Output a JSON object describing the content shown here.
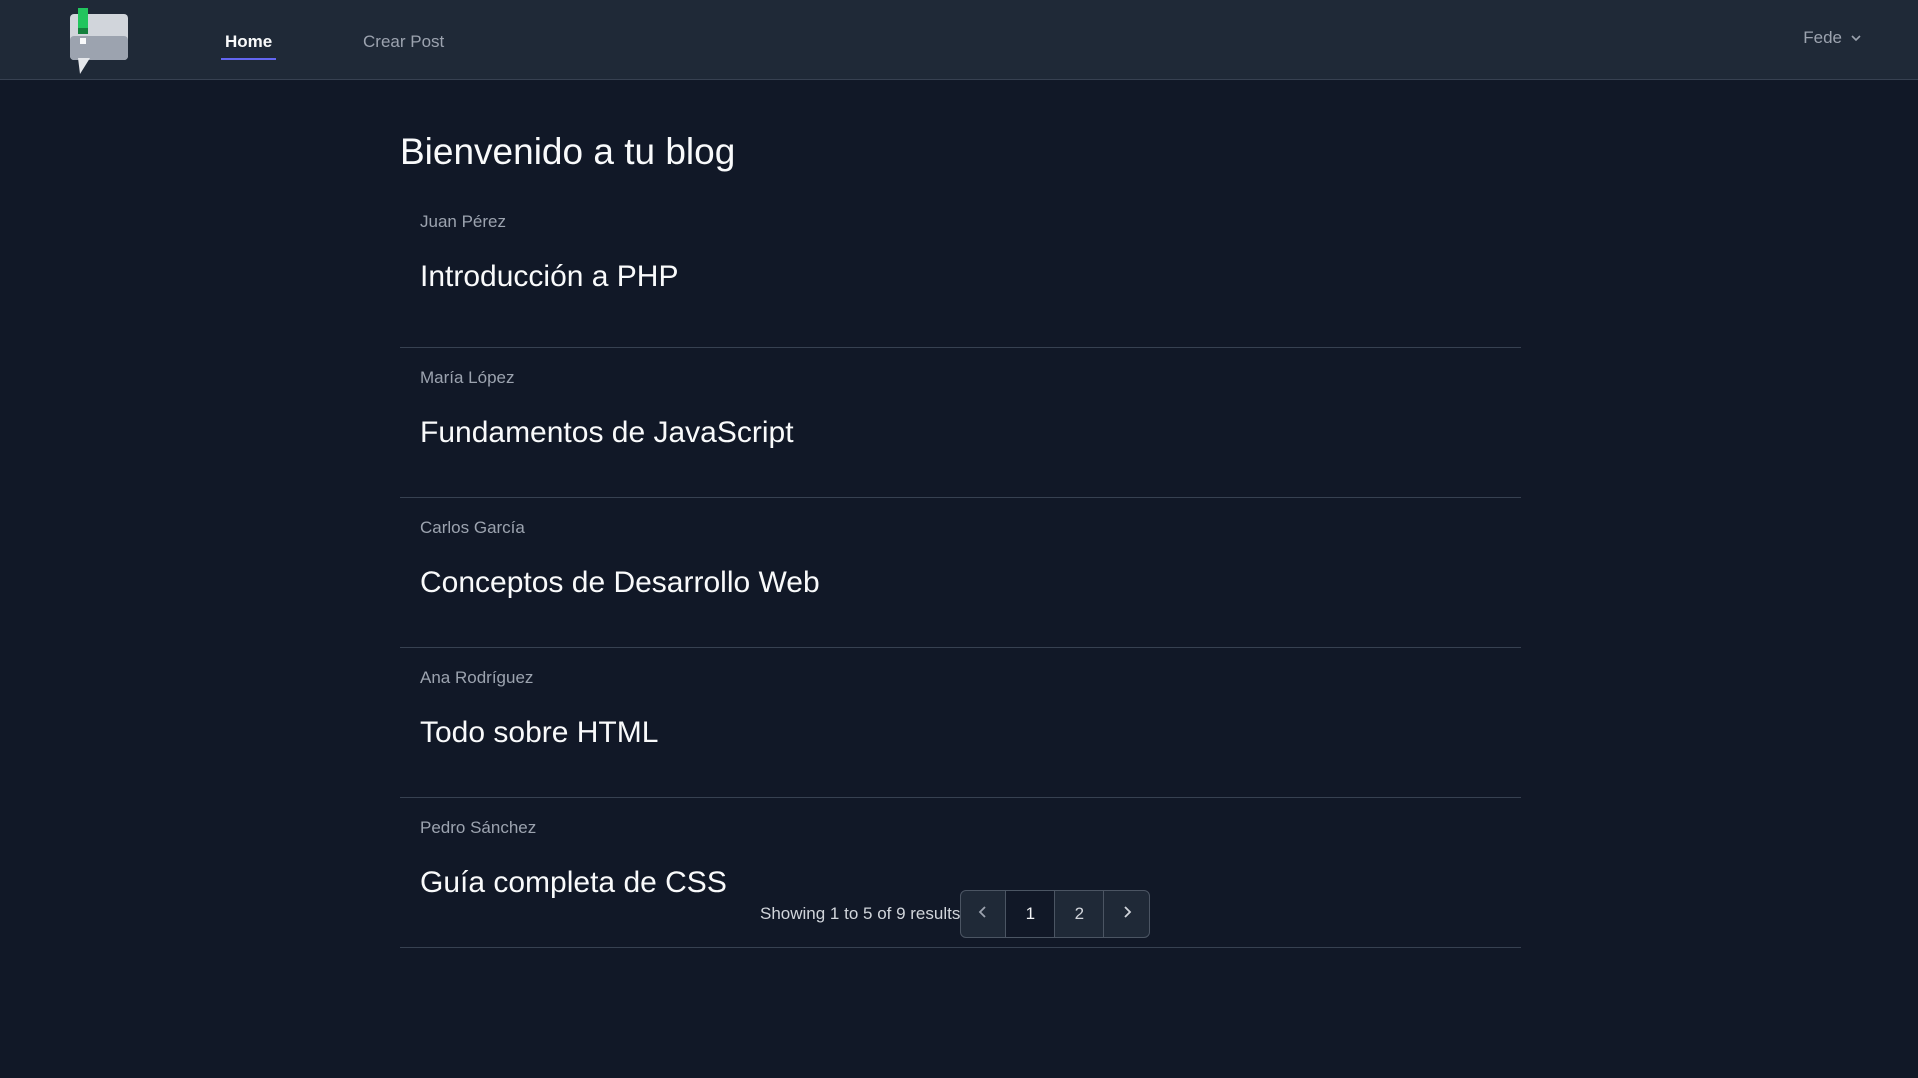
{
  "nav": {
    "home_label": "Home",
    "crear_label": "Crear Post",
    "user_name": "Fede"
  },
  "main": {
    "title": "Bienvenido a tu blog",
    "posts": [
      {
        "author": "Juan Pérez",
        "title": "Introducción a PHP"
      },
      {
        "author": "María López",
        "title": "Fundamentos de JavaScript"
      },
      {
        "author": "Carlos García",
        "title": "Conceptos de Desarrollo Web"
      },
      {
        "author": "Ana Rodríguez",
        "title": "Todo sobre HTML"
      },
      {
        "author": "Pedro Sánchez",
        "title": "Guía completa de CSS"
      }
    ]
  },
  "pagination": {
    "summary": "Showing 1 to 5 of 9 results",
    "pages": [
      "1",
      "2"
    ]
  },
  "colors": {
    "background": "#111827",
    "navbar": "#1f2937",
    "accent": "#6366f1"
  }
}
